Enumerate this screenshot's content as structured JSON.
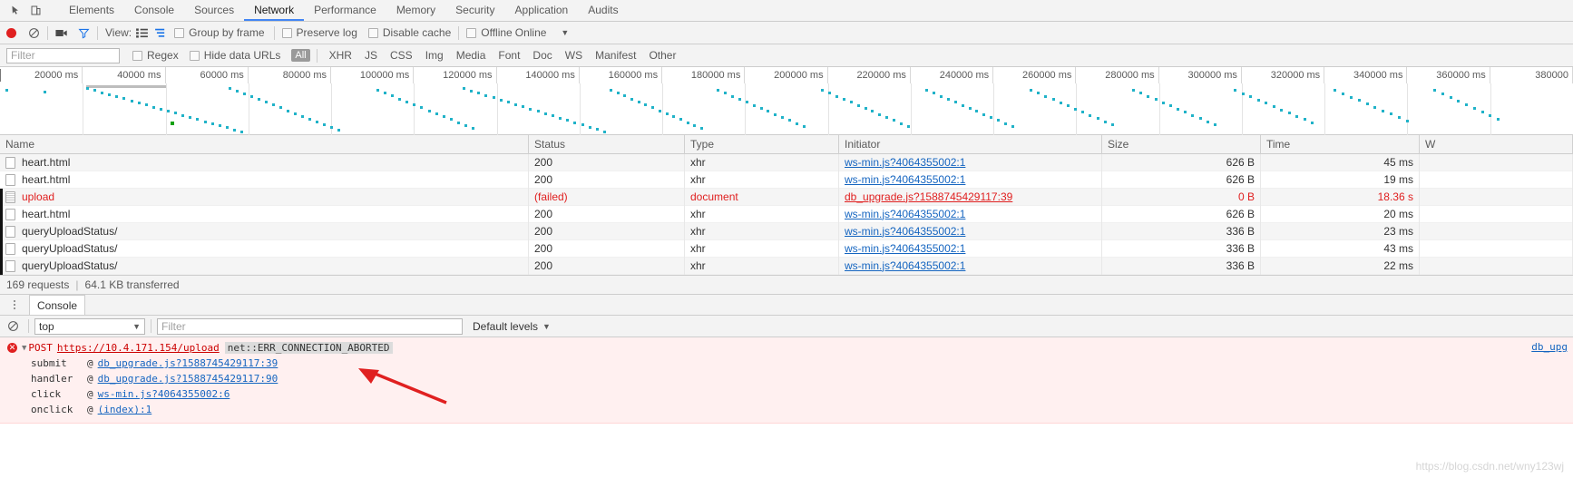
{
  "window": {
    "panel_icons": [
      "inspect-element-icon",
      "device-toolbar-icon"
    ]
  },
  "tabs": [
    {
      "label": "Elements",
      "active": false
    },
    {
      "label": "Console",
      "active": false
    },
    {
      "label": "Sources",
      "active": false
    },
    {
      "label": "Network",
      "active": true
    },
    {
      "label": "Performance",
      "active": false
    },
    {
      "label": "Memory",
      "active": false
    },
    {
      "label": "Security",
      "active": false
    },
    {
      "label": "Application",
      "active": false
    },
    {
      "label": "Audits",
      "active": false
    }
  ],
  "network_toolbar": {
    "record_title": "record-button",
    "clear_title": "clear-button",
    "capture_screenshots_title": "camera-icon",
    "filter_title": "funnel-icon",
    "view_label": "View:",
    "checkboxes": [
      {
        "label": "Group by frame",
        "checked": false
      },
      {
        "label": "Preserve log",
        "checked": false
      },
      {
        "label": "Disable cache",
        "checked": false
      },
      {
        "label": "Offline",
        "checked": false
      }
    ],
    "throttling_value": "Online",
    "throttling_caret": "▼"
  },
  "filter_bar": {
    "filter_placeholder": "Filter",
    "filter_value": "",
    "regex_label": "Regex",
    "regex_checked": false,
    "hide_data_urls_label": "Hide data URLs",
    "hide_data_urls_checked": false,
    "types": [
      "All",
      "XHR",
      "JS",
      "CSS",
      "Img",
      "Media",
      "Font",
      "Doc",
      "WS",
      "Manifest",
      "Other"
    ],
    "selected_type": "All"
  },
  "overview": {
    "ticks": [
      "20000 ms",
      "40000 ms",
      "60000 ms",
      "80000 ms",
      "100000 ms",
      "120000 ms",
      "140000 ms",
      "160000 ms",
      "180000 ms",
      "200000 ms",
      "220000 ms",
      "240000 ms",
      "260000 ms",
      "280000 ms",
      "300000 ms",
      "320000 ms",
      "340000 ms",
      "360000 ms",
      "380000"
    ],
    "dot_color": "#20b2c8",
    "event_color": "#13a10e"
  },
  "table": {
    "columns": [
      "Name",
      "Status",
      "Type",
      "Initiator",
      "Size",
      "Time",
      "W"
    ],
    "rows": [
      {
        "name": "heart.html",
        "icon": "checkbox-file-icon",
        "status": "200",
        "type": "xhr",
        "initiator": "ws-min.js?4064355002:1",
        "size": "626 B",
        "time": "45 ms",
        "failed": false
      },
      {
        "name": "heart.html",
        "icon": "checkbox-file-icon",
        "status": "200",
        "type": "xhr",
        "initiator": "ws-min.js?4064355002:1",
        "size": "626 B",
        "time": "19 ms",
        "failed": false
      },
      {
        "name": "upload",
        "icon": "document-icon",
        "status": "(failed)",
        "type": "document",
        "initiator": "db_upgrade.js?1588745429117:39",
        "size": "0 B",
        "time": "18.36 s",
        "failed": true
      },
      {
        "name": "heart.html",
        "icon": "checkbox-file-icon",
        "status": "200",
        "type": "xhr",
        "initiator": "ws-min.js?4064355002:1",
        "size": "626 B",
        "time": "20 ms",
        "failed": false
      },
      {
        "name": "queryUploadStatus/",
        "icon": "checkbox-file-icon",
        "status": "200",
        "type": "xhr",
        "initiator": "ws-min.js?4064355002:1",
        "size": "336 B",
        "time": "23 ms",
        "failed": false
      },
      {
        "name": "queryUploadStatus/",
        "icon": "checkbox-file-icon",
        "status": "200",
        "type": "xhr",
        "initiator": "ws-min.js?4064355002:1",
        "size": "336 B",
        "time": "43 ms",
        "failed": false
      },
      {
        "name": "queryUploadStatus/",
        "icon": "checkbox-file-icon",
        "status": "200",
        "type": "xhr",
        "initiator": "ws-min.js?4064355002:1",
        "size": "336 B",
        "time": "22 ms",
        "failed": false
      }
    ]
  },
  "summary": {
    "requests": "169 requests",
    "divider": "|",
    "transferred": "64.1 KB transferred"
  },
  "drawer": {
    "tab_label": "Console",
    "more_icon": "kebab-menu-icon",
    "clear_console_icon": "clear-console-icon",
    "context_value": "top",
    "context_caret": "▼",
    "filter_placeholder": "Filter",
    "filter_value": "",
    "levels_label": "Default levels",
    "levels_caret": "▼"
  },
  "console": {
    "error": {
      "badge": "✕",
      "disclosure": "▼",
      "method": "POST",
      "url": "https://10.4.171.154/upload",
      "code": "net::ERR_CONNECTION_ABORTED",
      "source_right": "db_upg",
      "stack": [
        {
          "fn": "submit",
          "at": "@",
          "link": "db_upgrade.js?1588745429117:39"
        },
        {
          "fn": "handler",
          "at": "@",
          "link": "db_upgrade.js?1588745429117:90"
        },
        {
          "fn": "click",
          "at": "@",
          "link": "ws-min.js?4064355002:6"
        },
        {
          "fn": "onclick",
          "at": "@",
          "link": "(index):1"
        }
      ]
    }
  },
  "annotation": {
    "arrow_color": "#e02020",
    "name": "red-pointer-arrow"
  },
  "watermark": "https://blog.csdn.net/wny123wj"
}
